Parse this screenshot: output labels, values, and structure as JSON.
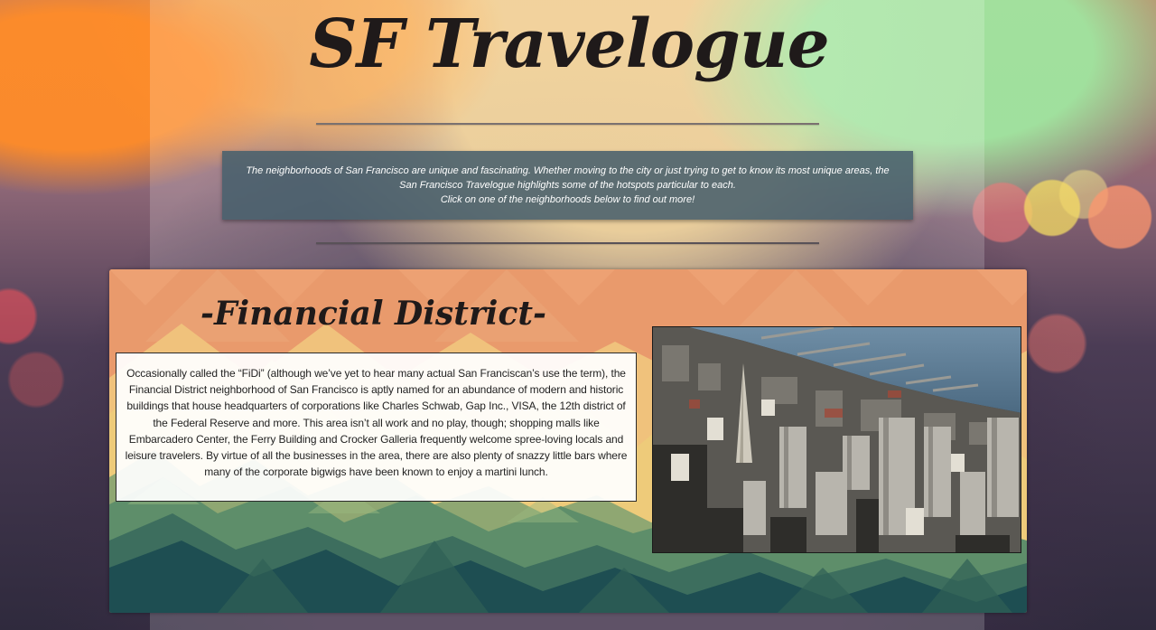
{
  "header": {
    "title": "SF Travelogue"
  },
  "intro": {
    "line1": "The neighborhoods of San Francisco are unique and fascinating. Whether moving to the city or just trying to get to know its most unique areas, the San Francisco Travelogue highlights some of the hotspots particular to each.",
    "line2": "Click on one of the neighborhoods below to find out more!"
  },
  "neighborhood": {
    "title": "-Financial District-",
    "description": "Occasionally called the “FiDi” (although we’ve yet to hear many actual San Franciscan’s use the term), the Financial District neighborhood of San Francisco is aptly named for an abundance of modern and historic buildings that house headquarters of corporations like Charles Schwab, Gap Inc., VISA, the 12th district of the Federal Reserve and more. This area isn’t all work and no play, though; shopping malls like Embarcadero Center, the Ferry Building and Crocker Galleria frequently welcome spree-loving locals and leisure travelers. By virtue of all the businesses in the area, there are also plenty of snazzy little bars where many of the corporate bigwigs have been known to enjoy a martini lunch.",
    "photo_subject": "aerial view of Financial District"
  },
  "colors": {
    "intro_bg": "#48606c",
    "card_top": "#e89a6c",
    "card_mid": "#eecb7a",
    "card_green": "#5e8e6a",
    "card_dark": "#1e4e52"
  }
}
